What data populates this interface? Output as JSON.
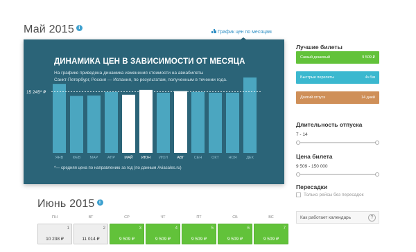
{
  "colors": {
    "accent": "#3ea1cf",
    "overlay_bg": "#2b6478",
    "bar": "#4ba6c0",
    "bar_highlight": "#ffffff",
    "cheapest": "#62c23a",
    "fast": "#3bb8cf",
    "long": "#cf8f58",
    "calendar_green": "#62c23a",
    "calendar_gray": "#eeeeee"
  },
  "may_section": {
    "title": "Май 2015",
    "info_icon": "info-icon",
    "chart_link": "График цен по месяцам",
    "chart_link_icon": "bar-chart-icon"
  },
  "overlay": {
    "title": "ДИНАМИКА ЦЕН В ЗАВИСИМОСТИ ОТ МЕСЯЦА",
    "description_line1": "На графике приведена динамика изменения стоимости на авиабилеты",
    "description_line2": "Санкт-Петербург, Россия — Испания, по результатам, полученным в течении года.",
    "footnote": "*— средняя цена по направлению за год (по данным Aviasales.ru)",
    "average_label": "15 245* ₽"
  },
  "chart_data": {
    "type": "bar",
    "categories": [
      "ЯНВ",
      "ФЕВ",
      "МАР",
      "АПР",
      "МАЙ",
      "ИЮН",
      "ИЮЛ",
      "АВГ",
      "СЕН",
      "ОКТ",
      "НОЯ",
      "ДЕК"
    ],
    "values": [
      17200,
      14200,
      14300,
      15200,
      14500,
      15700,
      15000,
      15400,
      15200,
      15000,
      15000,
      18800
    ],
    "highlighted": [
      "МАЙ",
      "ИЮН",
      "АВГ"
    ],
    "average": 15245,
    "average_label": "15 245* ₽",
    "ylim": [
      0,
      20500
    ],
    "grid": false,
    "legend": "none"
  },
  "sidebar": {
    "best_tickets_title": "Лучшие билеты",
    "tickets": [
      {
        "name": "Самый дешевый",
        "value": "9 509 ₽",
        "color": "#62c23a"
      },
      {
        "name": "Быстрые перелеты",
        "value": "4ч 5м",
        "color": "#3bb8cf"
      },
      {
        "name": "Долгий отпуск",
        "value": "14 дней",
        "color": "#cf8f58"
      }
    ],
    "duration": {
      "label": "Длительность отпуска",
      "range": "7 - 14",
      "low": 0.0,
      "high": 1.0
    },
    "price": {
      "label": "Цена билета",
      "range": "9 509 - 150 000",
      "low": 0.0,
      "high": 1.0
    },
    "transfers": {
      "label": "Пересадки",
      "checkbox_label": "Только рейсы без пересадок",
      "checked": false
    },
    "help": {
      "label": "Как работает календарь",
      "icon": "question-icon"
    }
  },
  "june_section": {
    "title": "Июнь 2015",
    "info_icon": "info-icon",
    "weekdays": [
      "ПН",
      "ВТ",
      "СР",
      "ЧТ",
      "ПТ",
      "СБ",
      "ВС"
    ],
    "days": [
      {
        "num": "1",
        "price": "10 238 ₽",
        "style": "gray"
      },
      {
        "num": "2",
        "price": "11 014 ₽",
        "style": "gray"
      },
      {
        "num": "3",
        "price": "9 509 ₽",
        "style": "green"
      },
      {
        "num": "4",
        "price": "9 509 ₽",
        "style": "green"
      },
      {
        "num": "5",
        "price": "9 509 ₽",
        "style": "green"
      },
      {
        "num": "6",
        "price": "9 509 ₽",
        "style": "green"
      },
      {
        "num": "7",
        "price": "9 509 ₽",
        "style": "green"
      }
    ]
  }
}
